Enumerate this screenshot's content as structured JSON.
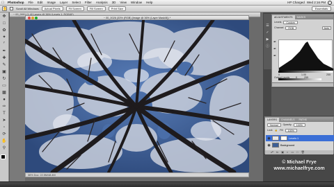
{
  "menubar": {
    "apple_icon": "apple-logo",
    "items": [
      "Photoshop",
      "File",
      "Edit",
      "Image",
      "Layer",
      "Select",
      "Filter",
      "Analysis",
      "3D",
      "View",
      "Window",
      "Help"
    ],
    "status_right": "HP Charged",
    "clock": "Wed 2:16 PM"
  },
  "options_bar": {
    "checkbox_label": "Scroll All Windows",
    "buttons": [
      "Actual Pixels",
      "Fit Screen",
      "Fill Screen",
      "Print Size"
    ],
    "workspace": "Essentials"
  },
  "background_document": {
    "title": "~ 00_0001 (1-40 Layers @ 36% (Levels 1, RGB/8*)"
  },
  "document": {
    "title": "~ 00_0026 (33% (RGB) (Image @ 36% (Layer Mask/8)) *",
    "status": "36%   Doc: 22.5M/48.4M"
  },
  "adjustments": {
    "tabs": [
      "ADJUSTMENTS",
      "MASKS"
    ],
    "preset_label": "Levels",
    "preset_value": "Custom",
    "channel_label": "Channel",
    "channel_value": "RGB",
    "auto_label": "Auto",
    "input_low": "0",
    "input_mid": "1.00",
    "input_high": "255",
    "output_label": "Output Levels",
    "output_low": "0",
    "output_high": "255"
  },
  "layers": {
    "tabs": [
      "LAYERS",
      "CHANNELS",
      "PATHS"
    ],
    "blend_mode": "Normal",
    "opacity_label": "Opacity",
    "opacity_value": "100%",
    "lock_label": "Lock",
    "fill_label": "Fill",
    "fill_value": "100%",
    "items": [
      {
        "name": "Levels 1",
        "selected": true
      },
      {
        "name": "Background",
        "selected": false
      }
    ]
  },
  "watermark": {
    "line1": "© Michael Frye",
    "line2": "www.michaelfrye.com"
  },
  "colors": {
    "selected_layer": "#3b6fd6",
    "sky": "#3d5f96"
  }
}
